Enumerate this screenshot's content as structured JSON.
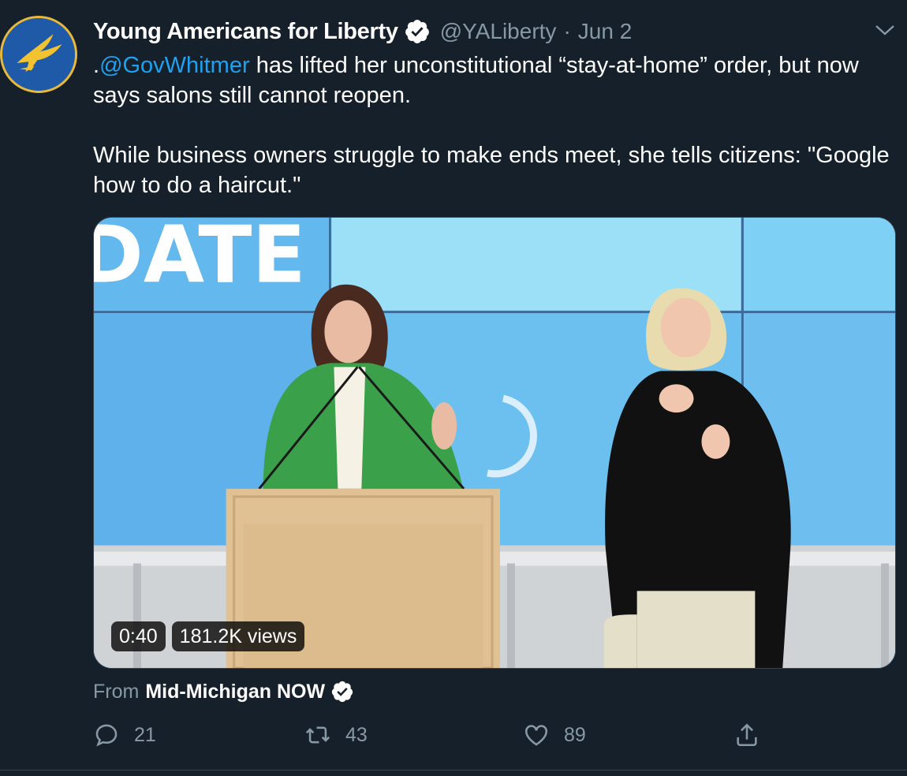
{
  "tweet": {
    "author_name": "Young Americans for Liberty",
    "handle": "@YALiberty",
    "separator": "·",
    "date": "Jun 2",
    "text_mention": "@GovWhitmer",
    "text_prefix": ".",
    "text_line1_rest": " has lifted her unconstitutional “stay-at-home” order, but now says salons still cannot reopen.",
    "text_para2": "While business owners struggle to make ends meet, she tells citizens: \"Google how to do a haircut.\""
  },
  "media": {
    "backdrop_text": "DATE",
    "duration": "0:40",
    "views": "181.2K views"
  },
  "source": {
    "from_label": "From",
    "name": "Mid-Michigan NOW"
  },
  "actions": {
    "reply_count": "21",
    "retweet_count": "43",
    "like_count": "89"
  },
  "icons": {
    "verified": "verified-badge-icon",
    "caret": "chevron-down-icon",
    "reply": "reply-icon",
    "retweet": "retweet-icon",
    "like": "heart-icon",
    "share": "share-icon"
  },
  "colors": {
    "background": "#15202b",
    "accent": "#1da1f2",
    "muted": "#8899a6"
  }
}
